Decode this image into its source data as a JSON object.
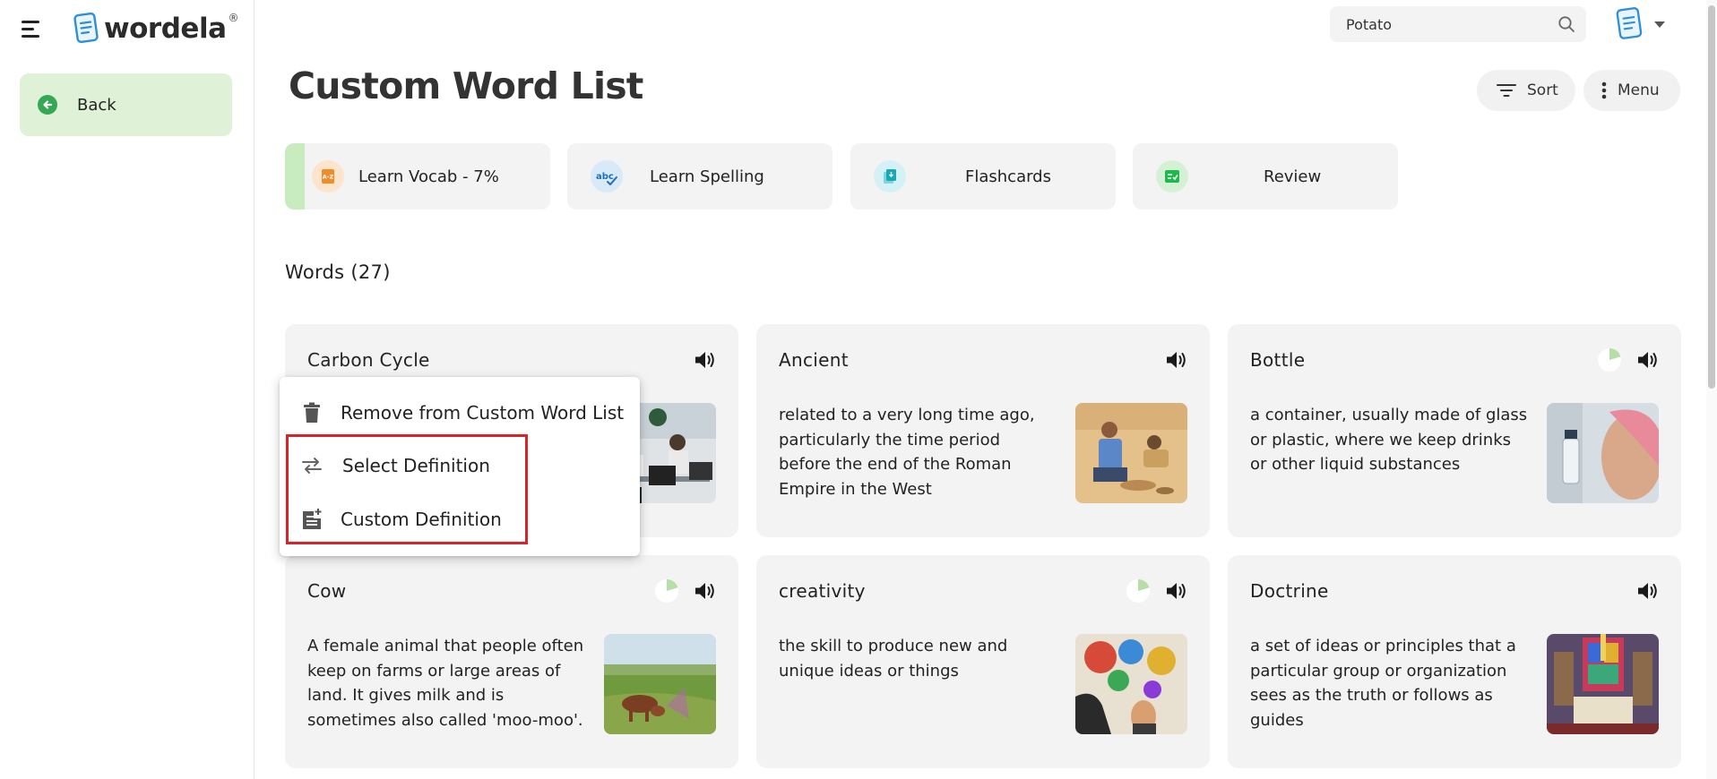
{
  "app": {
    "brand": "wordela",
    "brand_mark": "®"
  },
  "sidebar": {
    "back_label": "Back"
  },
  "search": {
    "value": "Potato"
  },
  "page": {
    "title": "Custom Word List"
  },
  "toolbar": {
    "sort_label": "Sort",
    "menu_label": "Menu"
  },
  "modes": [
    {
      "label": "Learn Vocab - 7%",
      "icon": "vocab-book-icon",
      "progress": 0.07
    },
    {
      "label": "Learn Spelling",
      "icon": "spelling-abc-icon"
    },
    {
      "label": "Flashcards",
      "icon": "flashcards-icon"
    },
    {
      "label": "Review",
      "icon": "review-icon"
    }
  ],
  "words_heading": "Words (27)",
  "cards": [
    {
      "word": "Carbon Cycle",
      "definition": ""
    },
    {
      "word": "Ancient",
      "definition": "related to a very long time ago, particularly the time period before the end of the Roman Empire in the West"
    },
    {
      "word": "Bottle",
      "definition": "a container, usually made of glass or plastic, where we keep drinks or other liquid substances",
      "progress": 0.15
    },
    {
      "word": "Cow",
      "definition": "A female animal that people often keep on farms or large areas of land. It gives milk and is sometimes also called 'moo-moo'.",
      "progress": 0.15
    },
    {
      "word": "creativity",
      "definition": "the skill to produce new and unique ideas or things",
      "progress": 0.15
    },
    {
      "word": "Doctrine",
      "definition": "a set of ideas or principles that a particular group or organization sees as the truth or follows as guides"
    }
  ],
  "context_menu": {
    "remove_label": "Remove from Custom Word List",
    "select_label": "Select Definition",
    "custom_label": "Custom Definition"
  },
  "colors": {
    "accent_green": "#34a853",
    "back_bg": "#dff2d8",
    "card_bg": "#f3f3f3",
    "highlight": "#d8232a",
    "progress_green": "#b5dfa6"
  }
}
